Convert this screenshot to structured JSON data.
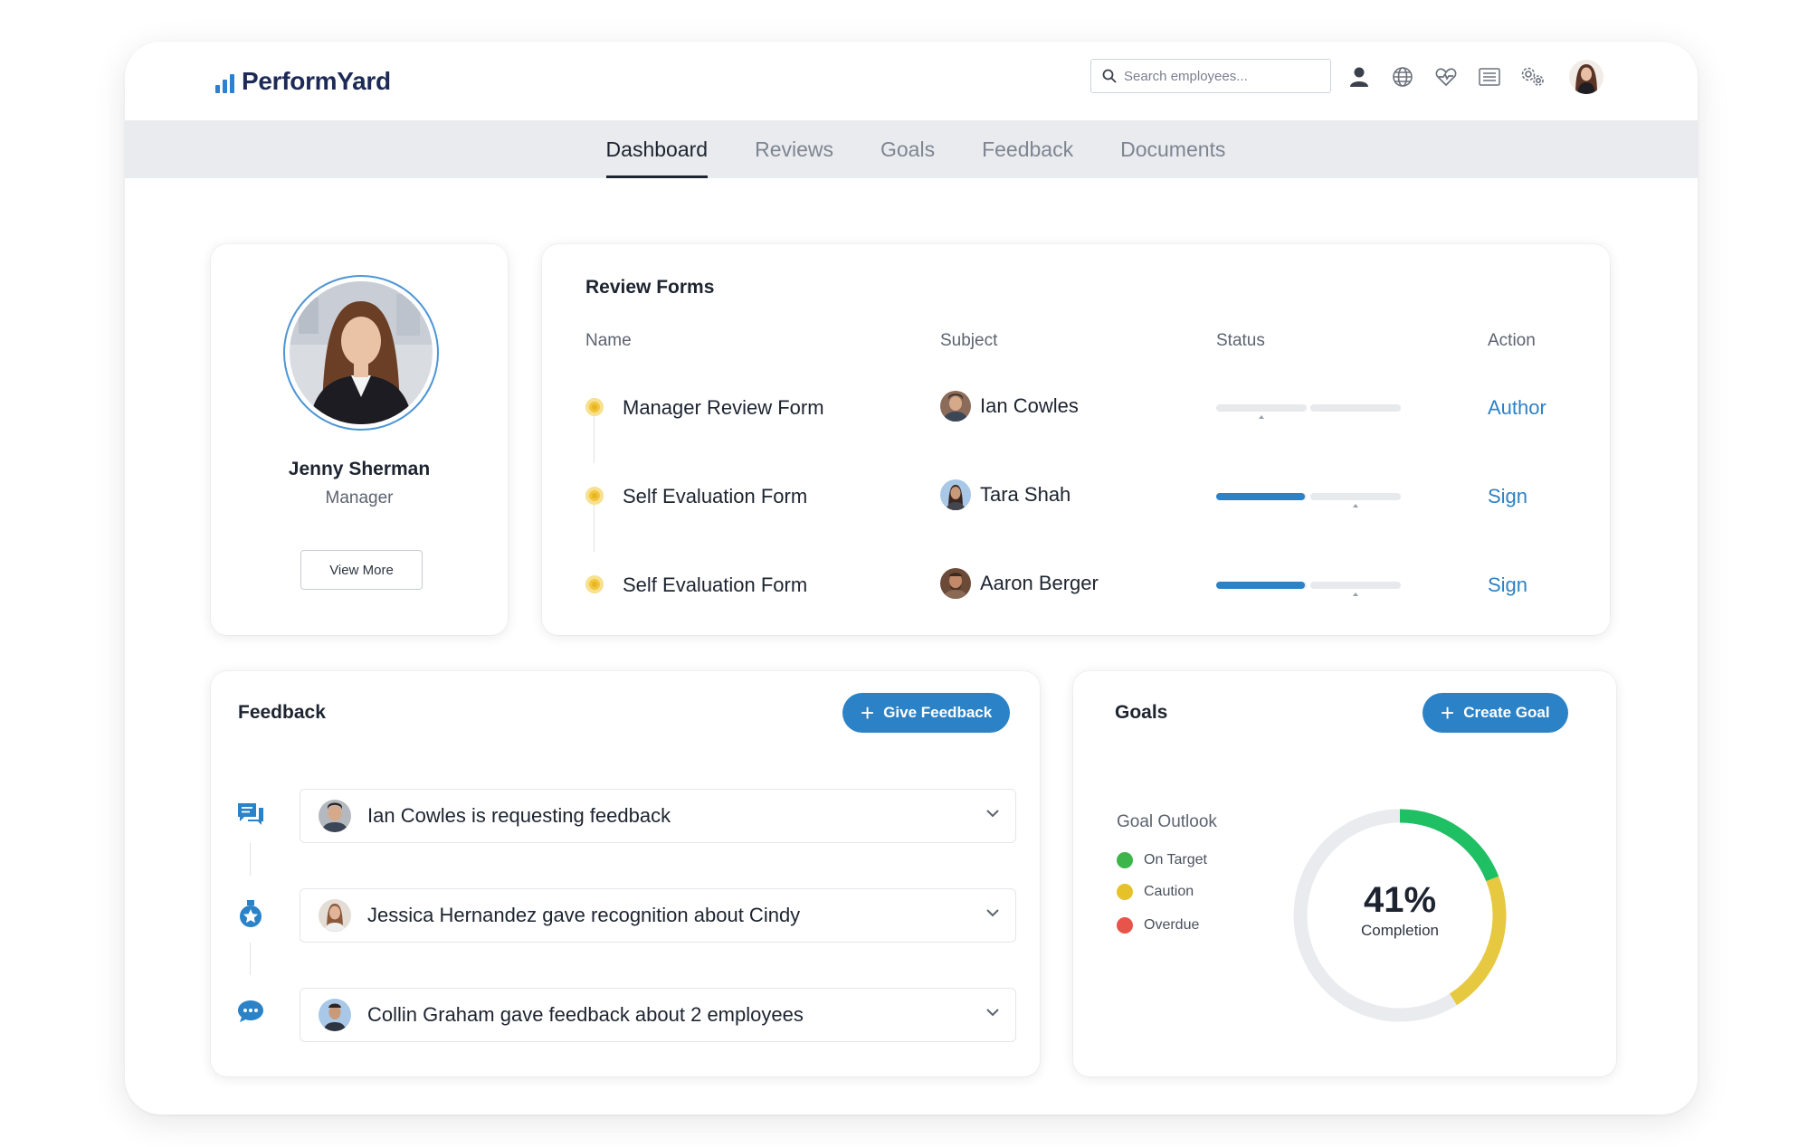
{
  "app": {
    "brand": "PerformYard"
  },
  "header": {
    "search_placeholder": "Search employees...",
    "icons": [
      "user-icon",
      "globe-icon",
      "heart-pulse-icon",
      "list-icon",
      "gears-icon"
    ]
  },
  "nav": {
    "tabs": [
      {
        "label": "Dashboard",
        "active": true
      },
      {
        "label": "Reviews",
        "active": false
      },
      {
        "label": "Goals",
        "active": false
      },
      {
        "label": "Feedback",
        "active": false
      },
      {
        "label": "Documents",
        "active": false
      }
    ]
  },
  "profile": {
    "name": "Jenny Sherman",
    "role": "Manager",
    "button": "View More"
  },
  "review": {
    "title": "Review Forms",
    "columns": {
      "name": "Name",
      "subject": "Subject",
      "status": "Status",
      "action": "Action"
    },
    "rows": [
      {
        "form": "Manager Review Form",
        "subject": "Ian Cowles",
        "progress": 0.0,
        "action": "Author"
      },
      {
        "form": "Self Evaluation Form",
        "subject": "Tara Shah",
        "progress": 0.5,
        "action": "Sign"
      },
      {
        "form": "Self Evaluation Form",
        "subject": "Aaron Berger",
        "progress": 0.5,
        "action": "Sign"
      }
    ]
  },
  "feedback": {
    "title": "Feedback",
    "button": "Give Feedback",
    "items": [
      {
        "text": "Ian Cowles is requesting feedback",
        "type_icon": "chat-bubbles-icon"
      },
      {
        "text": "Jessica Hernandez gave recognition about Cindy",
        "type_icon": "award-medal-icon"
      },
      {
        "text": "Collin Graham gave feedback about 2 employees",
        "type_icon": "message-dots-icon"
      }
    ]
  },
  "goals": {
    "title": "Goals",
    "button": "Create Goal",
    "outlook_title": "Goal Outlook",
    "legend": [
      {
        "label": "On Target",
        "color": "#3db54a"
      },
      {
        "label": "Caution",
        "color": "#e6c229"
      },
      {
        "label": "Overdue",
        "color": "#e8534a"
      }
    ],
    "completion_pct": "41%",
    "completion_label": "Completion"
  },
  "chart_data": {
    "type": "pie",
    "title": "",
    "categories": [
      "On Target",
      "Caution",
      "Remaining"
    ],
    "values": [
      19,
      22,
      59
    ],
    "colors": [
      "#1fbf63",
      "#e6c941",
      "#eaebef"
    ]
  }
}
